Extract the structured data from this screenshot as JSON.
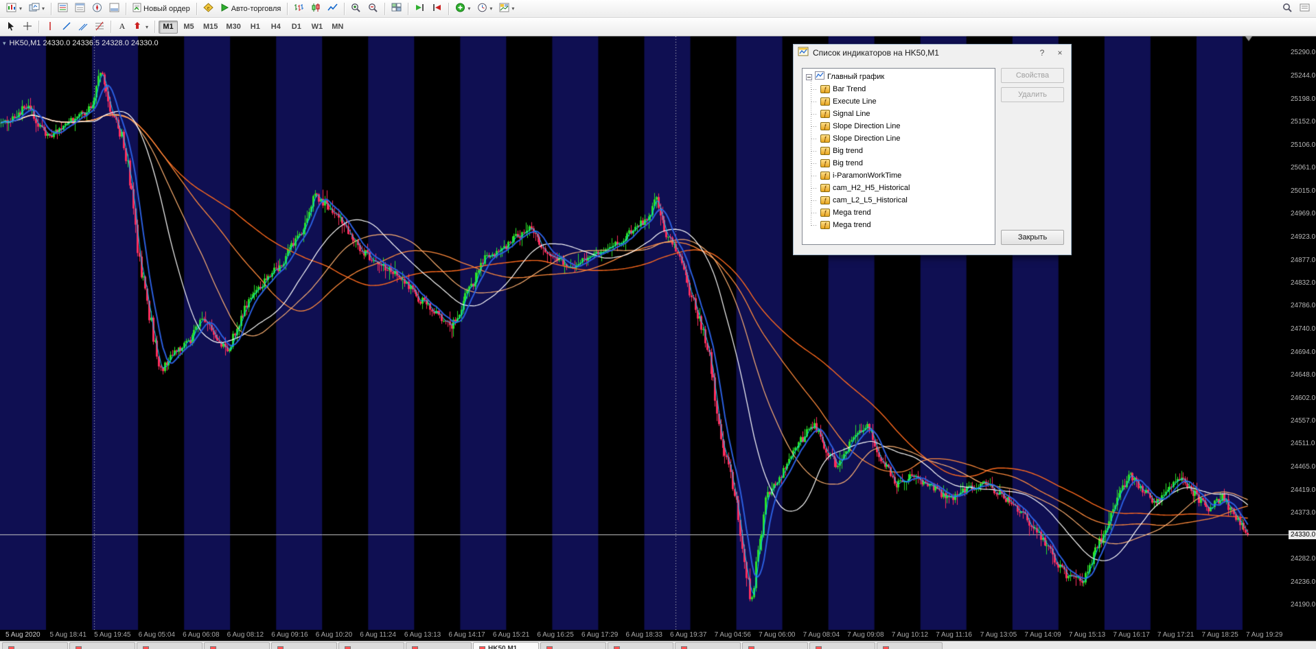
{
  "toolbar": {
    "new_order_label": "Новый ордер",
    "autotrading_label": "Авто-торговля"
  },
  "timeframes": {
    "items": [
      "M1",
      "M5",
      "M15",
      "M30",
      "H1",
      "H4",
      "D1",
      "W1",
      "MN"
    ],
    "active": "M1"
  },
  "chart": {
    "symbol": "HK50,M1",
    "ohlc": "HK50,M1  24330.0 24336.5 24328.0 24330.0",
    "oneclick_glyph": "▾",
    "current_price": "24330.0",
    "current_price_value": 24330,
    "price_min": 24140,
    "price_max": 25322,
    "right_gap": 58,
    "price_ticks": [
      "25290.0",
      "25244.0",
      "25198.0",
      "25152.0",
      "25106.0",
      "25061.0",
      "25015.0",
      "24969.0",
      "24923.0",
      "24877.0",
      "24832.0",
      "24786.0",
      "24740.0",
      "24694.0",
      "24648.0",
      "24602.0",
      "24557.0",
      "24511.0",
      "24465.0",
      "24419.0",
      "24373.0",
      "24282.0",
      "24236.0",
      "24190.0"
    ],
    "time_labels": [
      "5 Aug 2020",
      "5 Aug 18:41",
      "5 Aug 19:45",
      "6 Aug 05:04",
      "6 Aug 06:08",
      "6 Aug 08:12",
      "6 Aug 09:16",
      "6 Aug 10:20",
      "6 Aug 11:24",
      "6 Aug 13:13",
      "6 Aug 14:17",
      "6 Aug 15:21",
      "6 Aug 16:25",
      "6 Aug 17:29",
      "6 Aug 18:33",
      "6 Aug 19:37",
      "7 Aug 04:56",
      "7 Aug 06:00",
      "7 Aug 08:04",
      "7 Aug 09:08",
      "7 Aug 10:12",
      "7 Aug 11:16",
      "7 Aug 13:05",
      "7 Aug 14:09",
      "7 Aug 15:13",
      "7 Aug 16:17",
      "7 Aug 17:21",
      "7 Aug 18:25",
      "7 Aug 19:29"
    ],
    "separators": [
      0.073,
      0.524
    ],
    "bands": {
      "count": 28,
      "blue": "#0f0f52",
      "black": "#000000"
    },
    "price_line_color": "#c8c8c8",
    "candles": {
      "count": 640,
      "seed": 11,
      "up": "#2ae02a",
      "down": "#ff2e5e",
      "base_vol": 6,
      "wick_vol": 20
    },
    "waypoints": [
      [
        0.0,
        25150
      ],
      [
        0.012,
        25160
      ],
      [
        0.02,
        25185
      ],
      [
        0.03,
        25150
      ],
      [
        0.038,
        25120
      ],
      [
        0.05,
        25145
      ],
      [
        0.062,
        25160
      ],
      [
        0.072,
        25180
      ],
      [
        0.078,
        25240
      ],
      [
        0.082,
        25250
      ],
      [
        0.088,
        25170
      ],
      [
        0.098,
        25120
      ],
      [
        0.105,
        25000
      ],
      [
        0.112,
        24860
      ],
      [
        0.12,
        24760
      ],
      [
        0.127,
        24650
      ],
      [
        0.138,
        24690
      ],
      [
        0.15,
        24710
      ],
      [
        0.162,
        24760
      ],
      [
        0.172,
        24720
      ],
      [
        0.182,
        24695
      ],
      [
        0.195,
        24780
      ],
      [
        0.21,
        24830
      ],
      [
        0.225,
        24870
      ],
      [
        0.238,
        24920
      ],
      [
        0.252,
        25005
      ],
      [
        0.262,
        24985
      ],
      [
        0.275,
        24950
      ],
      [
        0.288,
        24900
      ],
      [
        0.302,
        24870
      ],
      [
        0.318,
        24850
      ],
      [
        0.335,
        24800
      ],
      [
        0.35,
        24770
      ],
      [
        0.362,
        24745
      ],
      [
        0.375,
        24815
      ],
      [
        0.388,
        24880
      ],
      [
        0.4,
        24890
      ],
      [
        0.412,
        24920
      ],
      [
        0.425,
        24940
      ],
      [
        0.436,
        24900
      ],
      [
        0.447,
        24880
      ],
      [
        0.456,
        24862
      ],
      [
        0.468,
        24875
      ],
      [
        0.482,
        24895
      ],
      [
        0.497,
        24915
      ],
      [
        0.51,
        24945
      ],
      [
        0.52,
        24960
      ],
      [
        0.525,
        25005
      ],
      [
        0.531,
        24940
      ],
      [
        0.541,
        24900
      ],
      [
        0.552,
        24820
      ],
      [
        0.56,
        24760
      ],
      [
        0.568,
        24680
      ],
      [
        0.575,
        24560
      ],
      [
        0.582,
        24480
      ],
      [
        0.589,
        24400
      ],
      [
        0.596,
        24280
      ],
      [
        0.602,
        24190
      ],
      [
        0.608,
        24310
      ],
      [
        0.614,
        24400
      ],
      [
        0.623,
        24440
      ],
      [
        0.633,
        24480
      ],
      [
        0.644,
        24525
      ],
      [
        0.652,
        24550
      ],
      [
        0.661,
        24505
      ],
      [
        0.671,
        24465
      ],
      [
        0.683,
        24520
      ],
      [
        0.695,
        24545
      ],
      [
        0.706,
        24480
      ],
      [
        0.718,
        24430
      ],
      [
        0.73,
        24445
      ],
      [
        0.745,
        24430
      ],
      [
        0.76,
        24400
      ],
      [
        0.775,
        24420
      ],
      [
        0.79,
        24430
      ],
      [
        0.802,
        24410
      ],
      [
        0.814,
        24385
      ],
      [
        0.826,
        24350
      ],
      [
        0.84,
        24300
      ],
      [
        0.854,
        24250
      ],
      [
        0.868,
        24238
      ],
      [
        0.879,
        24300
      ],
      [
        0.891,
        24370
      ],
      [
        0.905,
        24450
      ],
      [
        0.916,
        24420
      ],
      [
        0.926,
        24390
      ],
      [
        0.936,
        24425
      ],
      [
        0.946,
        24440
      ],
      [
        0.956,
        24415
      ],
      [
        0.968,
        24380
      ],
      [
        0.98,
        24405
      ],
      [
        0.99,
        24365
      ],
      [
        1.0,
        24330
      ]
    ],
    "mas": [
      {
        "period": 120,
        "color": "#ff6a1e",
        "width": 1.4
      },
      {
        "period": 85,
        "color": "#ff8a3c",
        "width": 1.3
      },
      {
        "period": 55,
        "color": "#ffb273",
        "width": 1.2
      },
      {
        "period": 34,
        "color": "#ffffff",
        "width": 1.2
      },
      {
        "period": 8,
        "color": "#2b5fe0",
        "width": 2
      },
      {
        "period": 3,
        "color": "#00ccff",
        "width": 1
      }
    ]
  },
  "dialog": {
    "title": "Список индикаторов на HK50,M1",
    "help_label": "?",
    "close_glyph": "×",
    "root": "Главный график",
    "indicators": [
      "Bar Trend",
      "Execute Line",
      "Signal Line",
      "Slope Direction Line",
      "Slope Direction Line",
      "Big trend",
      "Big trend",
      "i-ParamonWorkTime",
      "cam_H2_H5_Historical",
      "cam_L2_L5_Historical",
      "Mega trend",
      "Mega trend"
    ],
    "buttons": {
      "properties": "Свойства",
      "delete": "Удалить",
      "close": "Закрыть"
    }
  },
  "bottom_tabs": {
    "count": 14,
    "active_index": 7,
    "active": "HK50,M1"
  }
}
